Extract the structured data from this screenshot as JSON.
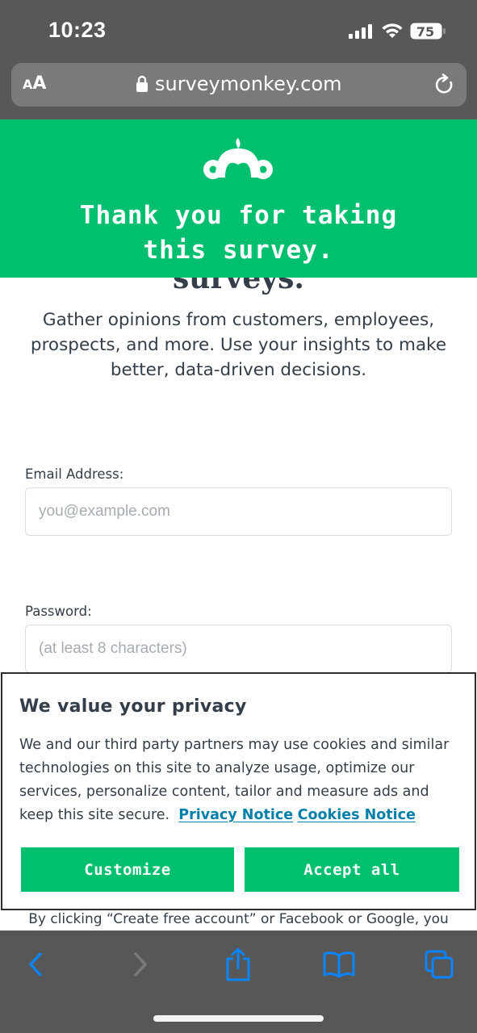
{
  "status_bar": {
    "time": "10:23",
    "battery": "75"
  },
  "browser": {
    "text_size_small": "A",
    "text_size_large": "A",
    "url": "surveymonkey.com"
  },
  "hero": {
    "line1": "Thank you for taking",
    "line2": "this survey."
  },
  "signup": {
    "cut_heading": "surveys.",
    "subtitle": "Gather opinions from customers, employees, prospects, and more. Use your insights to make better, data-driven decisions.",
    "email_label": "Email Address:",
    "email_placeholder": "you@example.com",
    "email_value": "",
    "password_label": "Password:",
    "password_placeholder": "(at least 8 characters)",
    "password_value": "",
    "footer_note": "By clicking “Create free account” or Facebook or Google, you"
  },
  "cookie_banner": {
    "title": "We value your privacy",
    "body": "We and our third party partners may use cookies and similar technologies on this site to analyze usage, optimize our services, personalize content, tailor and measure ads and keep this site secure.",
    "privacy_link": "Privacy Notice",
    "cookies_link": "Cookies Notice",
    "customize_label": "Customize",
    "accept_label": "Accept all"
  },
  "colors": {
    "brand_green": "#00bf6f",
    "link_blue": "#007faa",
    "text_dark": "#333e48",
    "ios_blue": "#0a84ff"
  },
  "icons": [
    "signal-icon",
    "wifi-icon",
    "battery-icon",
    "lock-icon",
    "reload-icon",
    "surveymonkey-logo",
    "back-icon",
    "forward-icon",
    "share-icon",
    "bookmarks-icon",
    "tabs-icon"
  ]
}
